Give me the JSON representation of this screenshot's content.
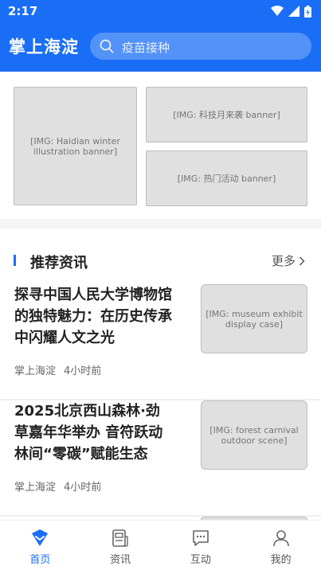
{
  "status_bar": {
    "time": "2:17"
  },
  "header": {
    "title": "掌上海淀",
    "search_placeholder": "疫苗接种"
  },
  "banners": {
    "left": "[IMG: Haidian winter illustration banner]",
    "right_top": "[IMG: 科技月来袭 banner]",
    "right_bottom": "[IMG: 热门活动 banner]"
  },
  "section": {
    "title": "推荐资讯",
    "more": "更多"
  },
  "news": [
    {
      "title": "探寻中国人民大学博物馆的独特魅力：在历史传承中闪耀人文之光",
      "source": "掌上海淀",
      "time": "4小时前",
      "thumb": "[IMG: museum exhibit display case]"
    },
    {
      "title": "2025北京西山森林·劲草嘉年华举办 音符跃动林间“零碳”赋能生态",
      "source": "掌上海淀",
      "time": "4小时前",
      "thumb": "[IMG: forest carnival outdoor scene]"
    }
  ],
  "tabs": [
    {
      "label": "首页",
      "icon": "home-icon",
      "active": true
    },
    {
      "label": "资讯",
      "icon": "news-icon",
      "active": false
    },
    {
      "label": "互动",
      "icon": "chat-icon",
      "active": false
    },
    {
      "label": "我的",
      "icon": "profile-icon",
      "active": false
    }
  ],
  "colors": {
    "primary": "#1a6ef5"
  }
}
